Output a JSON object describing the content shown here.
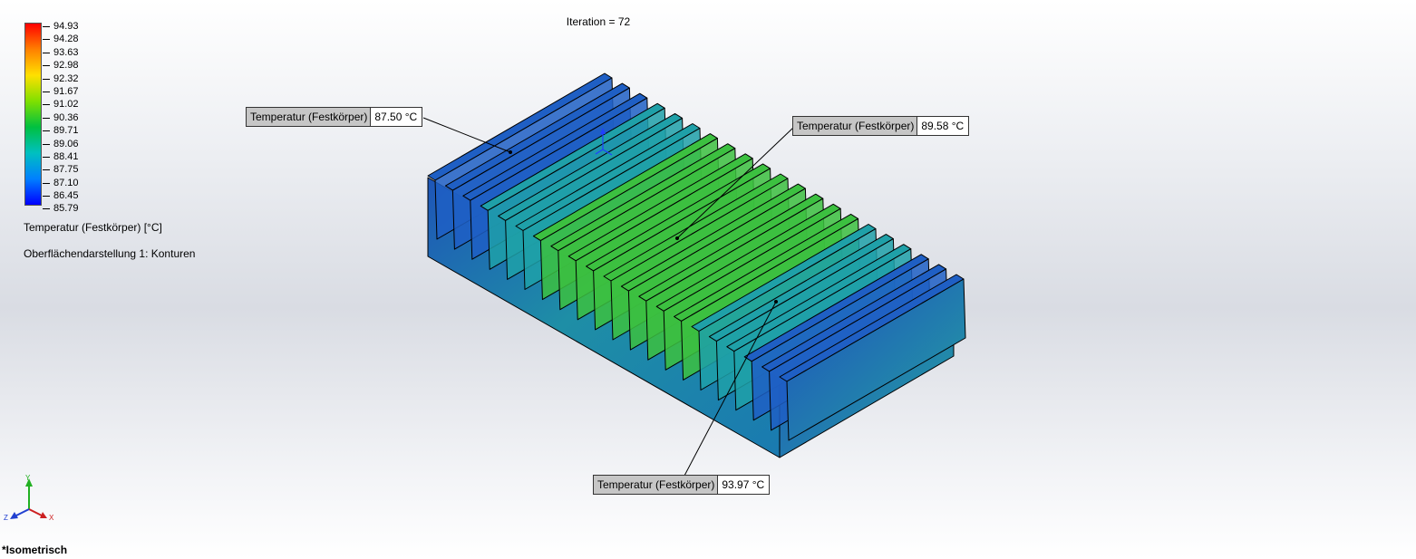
{
  "header": {
    "iteration": "Iteration = 72"
  },
  "legend": {
    "ticks": [
      "94.93",
      "94.28",
      "93.63",
      "92.98",
      "92.32",
      "91.67",
      "91.02",
      "90.36",
      "89.71",
      "89.06",
      "88.41",
      "87.75",
      "87.10",
      "86.45",
      "85.79"
    ],
    "title": "Temperatur (Festkörper) [°C]",
    "subtitle": "Oberflächendarstellung 1: Konturen",
    "gradient": [
      "#ff0000",
      "#ff8000",
      "#ffe000",
      "#80e000",
      "#00c040",
      "#00c0c0",
      "#0080ff",
      "#0000ff"
    ]
  },
  "probes": [
    {
      "label": "Temperatur (Festkörper)",
      "value": "87.50 °C"
    },
    {
      "label": "Temperatur (Festkörper)",
      "value": "89.58 °C"
    },
    {
      "label": "Temperatur (Festkörper)",
      "value": "93.97 °C"
    }
  ],
  "view": {
    "name": "*Isometrisch"
  },
  "triad": {
    "y": "Y",
    "x": "X",
    "z": "Z"
  },
  "colors": {
    "fin_cool": "#1f5fc4",
    "fin_mid": "#1fa0a8",
    "fin_warm": "#3cc040",
    "outline": "#000000"
  }
}
